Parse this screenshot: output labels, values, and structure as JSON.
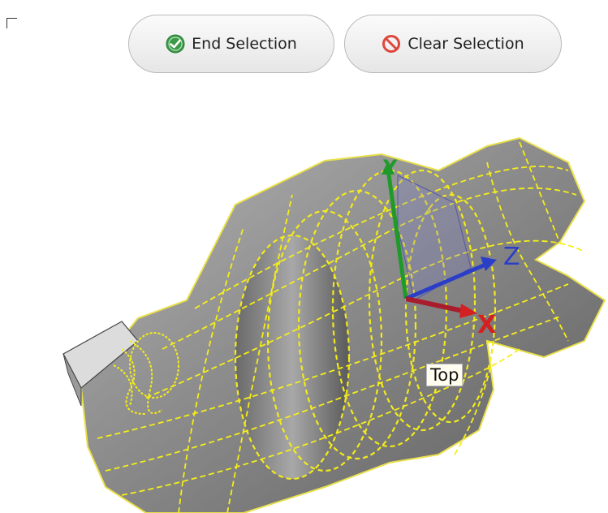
{
  "toolbar": {
    "end_selection_label": "End Selection",
    "clear_selection_label": "Clear Selection"
  },
  "icons": {
    "end_selection": "check-circle-icon",
    "clear_selection": "no-entry-icon"
  },
  "viewport": {
    "view_label": "Top",
    "axes": {
      "x": "X",
      "y": "Y",
      "z": "Z"
    }
  },
  "colors": {
    "axis_x": "#d42020",
    "axis_y": "#1f9a2a",
    "axis_z": "#2a3ec8",
    "mesh_edges": "#f5ee1a",
    "part_body": "#8a8a8a",
    "check_icon": "#3a9a46",
    "no_entry_icon": "#e0453a"
  }
}
